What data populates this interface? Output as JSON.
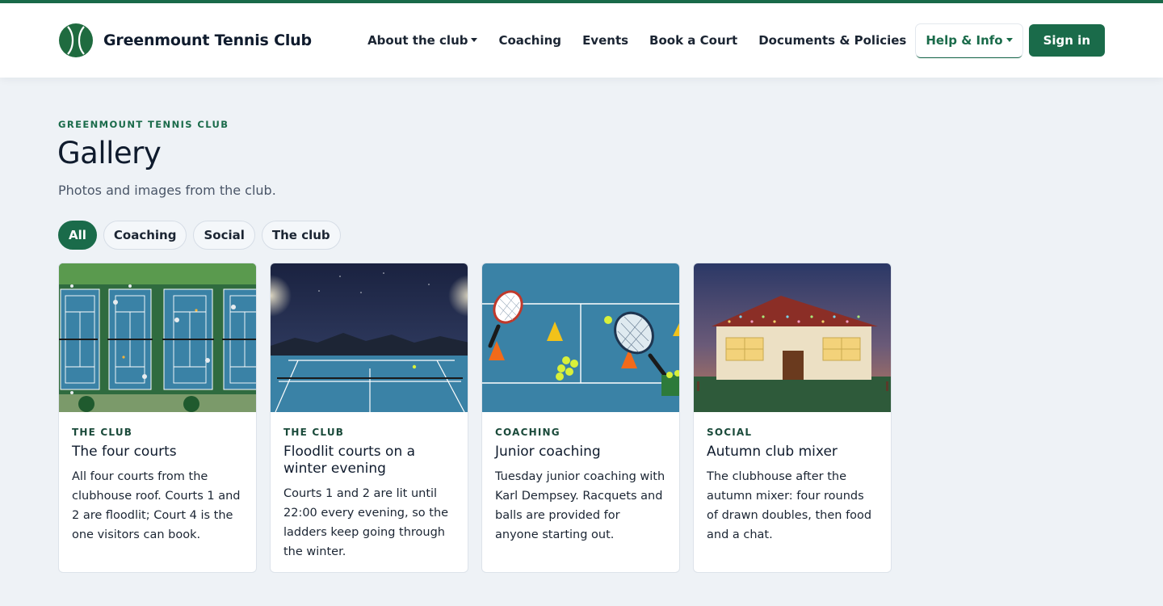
{
  "header": {
    "brand_name": "Greenmount Tennis Club",
    "logo_icon": "tennis-ball-icon",
    "nav": [
      {
        "label": "About the club",
        "dropdown": true
      },
      {
        "label": "Coaching",
        "dropdown": false
      },
      {
        "label": "Events",
        "dropdown": false
      },
      {
        "label": "Book a Court",
        "dropdown": false
      },
      {
        "label": "Documents & Policies",
        "dropdown": false
      },
      {
        "label": "Help & Info",
        "dropdown": true
      }
    ],
    "signin_label": "Sign in"
  },
  "page": {
    "eyebrow": "GREENMOUNT TENNIS CLUB",
    "title": "Gallery",
    "subtitle": "Photos and images from the club."
  },
  "filters": [
    {
      "label": "All",
      "active": true
    },
    {
      "label": "Coaching",
      "active": false
    },
    {
      "label": "Social",
      "active": false
    },
    {
      "label": "The club",
      "active": false
    }
  ],
  "cards": [
    {
      "tag": "THE CLUB",
      "title": "The four courts",
      "text": "All four courts from the clubhouse roof. Courts 1 and 2 are floodlit; Court 4 is the one visitors can book.",
      "image": "four-courts-aerial"
    },
    {
      "tag": "THE CLUB",
      "title": "Floodlit courts on a winter evening",
      "text": "Courts 1 and 2 are lit until 22:00 every evening, so the ladders keep going through the winter.",
      "image": "floodlit-courts-night"
    },
    {
      "tag": "COACHING",
      "title": "Junior coaching",
      "text": "Tuesday junior coaching with Karl Dempsey. Racquets and balls are provided for anyone starting out.",
      "image": "junior-coaching-racquets"
    },
    {
      "tag": "SOCIAL",
      "title": "Autumn club mixer",
      "text": "The clubhouse after the autumn mixer: four rounds of drawn doubles, then food and a chat.",
      "image": "clubhouse-dusk"
    }
  ],
  "colors": {
    "brand_green": "#1a6b4a",
    "page_bg": "#eef2f6",
    "court_blue": "#3a82a6"
  }
}
